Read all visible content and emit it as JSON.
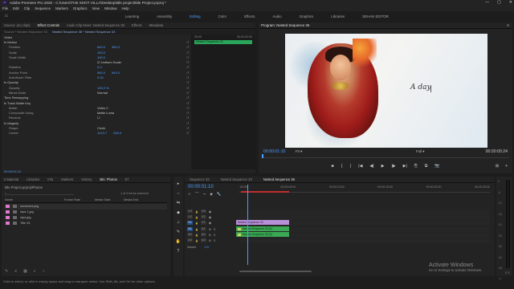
{
  "window": {
    "title": "Adobe Premiere Pro 2020 - C:\\Users\\THE SHOT VILLA\\Desktop\\title project\\title Project.prproj *",
    "logo_text": "Pr",
    "controls": [
      "—",
      "▢",
      "✕"
    ]
  },
  "menu": [
    "File",
    "Edit",
    "Clip",
    "Sequence",
    "Markers",
    "Graphics",
    "View",
    "Window",
    "Help"
  ],
  "workspaces": {
    "home_icon": "home-icon",
    "items": [
      "Learning",
      "Assembly",
      "Editing",
      "Color",
      "Effects",
      "Audio",
      "Graphics",
      "Libraries",
      "SEHAN EDITOR"
    ],
    "active": "Editing"
  },
  "effect_controls": {
    "tabs": [
      "Source: (no clips)",
      "Effect Controls",
      "Audio Clip Mixer: Nested Sequence 36",
      "Effects",
      "Metadata"
    ],
    "active_tab": "Effect Controls",
    "source": "Source * Nested Sequence 33",
    "sequence": "Nested Sequence 36 * Nested Sequence 33",
    "ruler": [
      "00:00",
      "00:00:02:00"
    ],
    "clip_bar": "Nested Sequence 33",
    "rows": [
      {
        "label": "Video",
        "values": [],
        "header": true
      },
      {
        "label": "fx  Motion",
        "values": [],
        "header": true
      },
      {
        "label": "Position",
        "values": [
          "640.0",
          "360.0"
        ]
      },
      {
        "label": "Scale",
        "values": [
          "100.0"
        ]
      },
      {
        "label": "Scale Width",
        "values": [
          "100.0"
        ]
      },
      {
        "label": "",
        "values": [
          "☑ Uniform Scale"
        ],
        "white": true
      },
      {
        "label": "Rotation",
        "values": [
          "0.0"
        ]
      },
      {
        "label": "Anchor Point",
        "values": [
          "960.0",
          "540.0"
        ]
      },
      {
        "label": "Anti-flicker Filter",
        "values": [
          "0.00"
        ]
      },
      {
        "label": "fx  Opacity",
        "values": [],
        "header": true
      },
      {
        "label": "Opacity",
        "values": [
          "100.0 %"
        ]
      },
      {
        "label": "Blend Mode",
        "values": [
          "Normal"
        ],
        "white": true
      },
      {
        "label": "Time Remapping",
        "values": [],
        "header": true
      },
      {
        "label": "fx  Track Matte Key",
        "values": [],
        "header": true
      },
      {
        "label": "Matte:",
        "values": [
          "Video 2"
        ],
        "white": true
      },
      {
        "label": "Composite Using",
        "values": [
          "Matte Luma"
        ],
        "white": true
      },
      {
        "label": "Reverse",
        "values": [
          "☐"
        ],
        "white": true
      },
      {
        "label": "fx  Magnify",
        "values": [],
        "header": true
      },
      {
        "label": "Shape",
        "values": [
          "Circle"
        ],
        "white": true
      },
      {
        "label": "Center",
        "values": [
          "1413.7",
          "540.0"
        ]
      }
    ],
    "footer_timecode": "00:00:01:10"
  },
  "program": {
    "title": "Program: Nested Sequence 36",
    "caption": "A day",
    "timecode_left": "00:00:01:10",
    "fit": "Fit",
    "resolution": "Full",
    "timecode_right": "00:00:00:24",
    "playhead_fraction": 0.0,
    "transport": [
      "⬥",
      "{",
      "}",
      "|◀",
      "◀|",
      "▶",
      "|▶",
      "▶|",
      "⎘",
      "⧉",
      "📷"
    ],
    "transport_extra": [
      "⊞",
      "+"
    ]
  },
  "project": {
    "tabs": [
      "s Material",
      "Libraries",
      "Info",
      "Markers",
      "History",
      "Bin: Photos",
      "Ef"
    ],
    "active_tab": "Bin: Photos",
    "path": "title Project.prproj\\Photos",
    "search_placeholder": "⌕",
    "selection_count": "1 of 4 items selected",
    "columns": [
      "Name",
      "Frame Rate",
      "Media Start",
      "Media End"
    ],
    "items": [
      {
        "name": "unnamed.png",
        "color": "#e07ad0",
        "selected": true
      },
      {
        "name": "mpa 1.jpg",
        "color": "#e07ad0",
        "selected": false
      },
      {
        "name": "mpa.jpg",
        "color": "#e07ad0",
        "selected": false
      },
      {
        "name": "Title 33",
        "color": "#e07ad0",
        "selected": false
      }
    ],
    "bottom_icons": [
      "✎",
      "≡",
      "▦",
      "◐",
      "○"
    ]
  },
  "tools": [
    "▸",
    "⇔",
    "⇆",
    "◆",
    "⊥",
    "✎",
    "✋",
    "T"
  ],
  "timeline": {
    "tabs": [
      "Sequence 33",
      "Nested Sequence 33",
      "Nested Sequence 36"
    ],
    "active_tab": "Nested Sequence 36",
    "timecode": "00:00:01:10",
    "ruler": [
      ":00:00",
      "00:00:05:00",
      "00:00:10:00",
      "00:00:15:00",
      "00:00:20:00",
      "00:00:25:00"
    ],
    "tool_icons": [
      "⊹",
      "⌒",
      "⊸",
      "◆",
      "🔧"
    ],
    "tracks": [
      {
        "id": "V3",
        "target": false
      },
      {
        "id": "V2",
        "target": false
      },
      {
        "id": "V1",
        "target": true
      },
      {
        "id": "A1",
        "target": true
      },
      {
        "id": "A2",
        "target": false
      },
      {
        "id": "A3",
        "target": false
      }
    ],
    "clips": {
      "v3": "Nested Sequence 33",
      "v2": "Nested Sequence 33 [V]",
      "v1": "Nested Sequence 33 [V]"
    },
    "master_label": "Master",
    "master_value": "0.0"
  },
  "meter": {
    "scale": [
      "0",
      "-6",
      "-12",
      "-18",
      "-24",
      "-30",
      "-36",
      "-42",
      "-48",
      "-54",
      "dB"
    ],
    "sm": "S S"
  },
  "status": "Click to select, or click in empty space and drag to marquee select. Use Shift, Alt, and Ctrl for other options.",
  "watermark": {
    "line1": "Activate Windows",
    "line2": "Go to Settings to activate Windows."
  }
}
